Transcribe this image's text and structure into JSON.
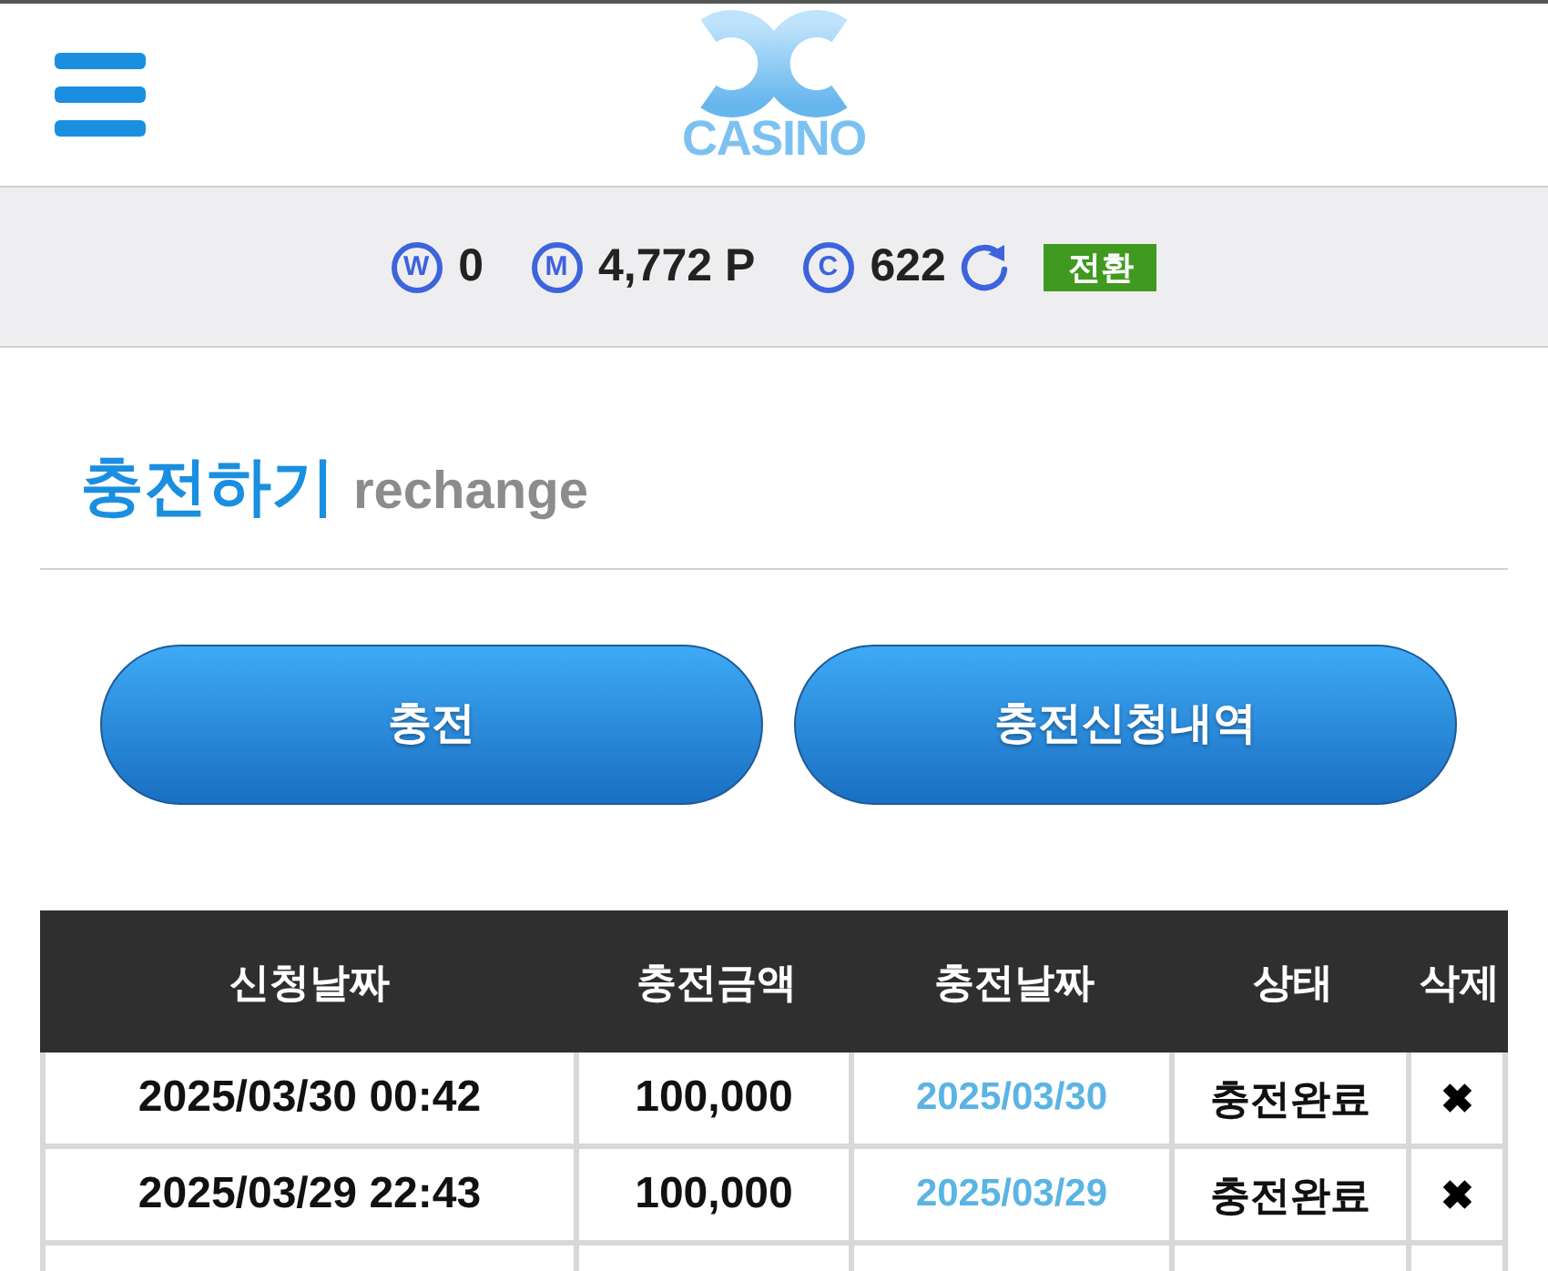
{
  "header": {
    "logo_text": "CASINO"
  },
  "balances": [
    {
      "kind": "won",
      "icon": "W",
      "value": "0"
    },
    {
      "kind": "money",
      "icon": "M",
      "value": "4,772 P"
    },
    {
      "kind": "comp",
      "icon": "C",
      "value": "622",
      "refresh": true
    }
  ],
  "convert_button": {
    "label": "전환"
  },
  "section": {
    "title": "충전하기",
    "subtitle": "rechange"
  },
  "buttons": [
    {
      "label": "충전"
    },
    {
      "label": "충전신청내역"
    }
  ],
  "table": {
    "columns": [
      "신청날짜",
      "충전금액",
      "충전날짜",
      "상태",
      "삭제"
    ],
    "rows": [
      {
        "requested": "2025/03/30 00:42",
        "amount": "100,000",
        "charged": "2025/03/30",
        "status": "충전완료",
        "delete": "✖"
      },
      {
        "requested": "2025/03/29 22:43",
        "amount": "100,000",
        "charged": "2025/03/29",
        "status": "충전완료",
        "delete": "✖"
      }
    ]
  }
}
